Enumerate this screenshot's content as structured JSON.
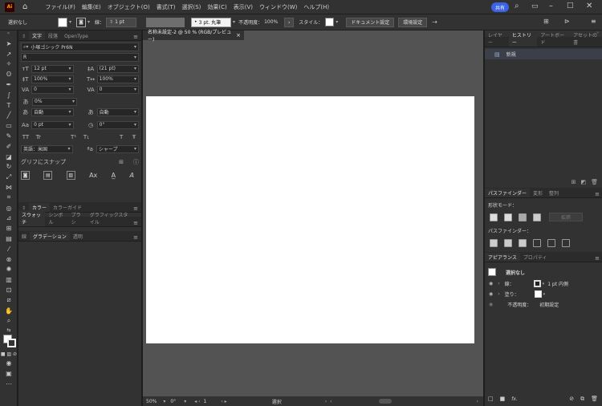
{
  "menubar": {
    "logo": "Ai",
    "items": [
      "ファイル(F)",
      "編集(E)",
      "オブジェクト(O)",
      "書式(T)",
      "選択(S)",
      "効果(C)",
      "表示(V)",
      "ウィンドウ(W)",
      "ヘルプ(H)"
    ],
    "share": "共有"
  },
  "controlbar": {
    "selection": "選択なし",
    "stroke_label": "線：",
    "stroke_weight": "1 pt",
    "brush": "3 pt. 丸筆",
    "opacity_label": "不透明度：",
    "opacity_value": "100%",
    "style_label": "スタイル：",
    "doc_settings": "ドキュメント設定",
    "env_settings": "環境設定"
  },
  "char_panel": {
    "tabs": [
      "文字",
      "段落",
      "OpenType"
    ],
    "font_family": "小塚ゴシック Pr6N",
    "font_style": "R",
    "size": "12 pt",
    "leading": "(21 pt)",
    "vscale": "100%",
    "hscale": "100%",
    "kerning": "0",
    "tracking": "0",
    "tsume": "0%",
    "mojikumi1": "自動",
    "mojikumi2": "自動",
    "baseline": "0 pt",
    "rotation": "0°",
    "language": "英語：米国",
    "antialias": "シャープ",
    "snap": "グリフにスナップ",
    "tt": "TT",
    "tr": "Tr",
    "t1": "T¹",
    "t2": "T₁",
    "t3": "T",
    "t4": "Ŧ"
  },
  "color_tabs": [
    "カラー",
    "カラーガイド"
  ],
  "swatch_tabs": [
    "スウォッチ",
    "シンボル",
    "ブラシ",
    "グラフィックスタイル"
  ],
  "gradient_tabs": [
    "線",
    "グラデーション",
    "透明"
  ],
  "document": {
    "tab_title": "名称未設定-2 @ 50 % (RGB/プレビュー)",
    "close": "×"
  },
  "status": {
    "zoom": "50%",
    "rotate": "0°",
    "artboard": "1",
    "tool": "選択"
  },
  "history": {
    "tabs": [
      "レイヤー",
      "ヒストリー",
      "アートボード",
      "アセットの書"
    ],
    "items": [
      "新規"
    ]
  },
  "pathfinder": {
    "tabs": [
      "パスファインダー",
      "変形",
      "整列"
    ],
    "shape_modes": "形状モード：",
    "expand": "拡張",
    "pathfinders": "パスファインダー："
  },
  "appearance": {
    "tabs": [
      "アピアランス",
      "プロパティ"
    ],
    "title": "選択なし",
    "stroke_label": "線：",
    "stroke_value": "1 pt 内側",
    "fill_label": "塗り：",
    "opacity_label": "不透明度：",
    "opacity_value": "初期設定",
    "fx": "fx."
  }
}
